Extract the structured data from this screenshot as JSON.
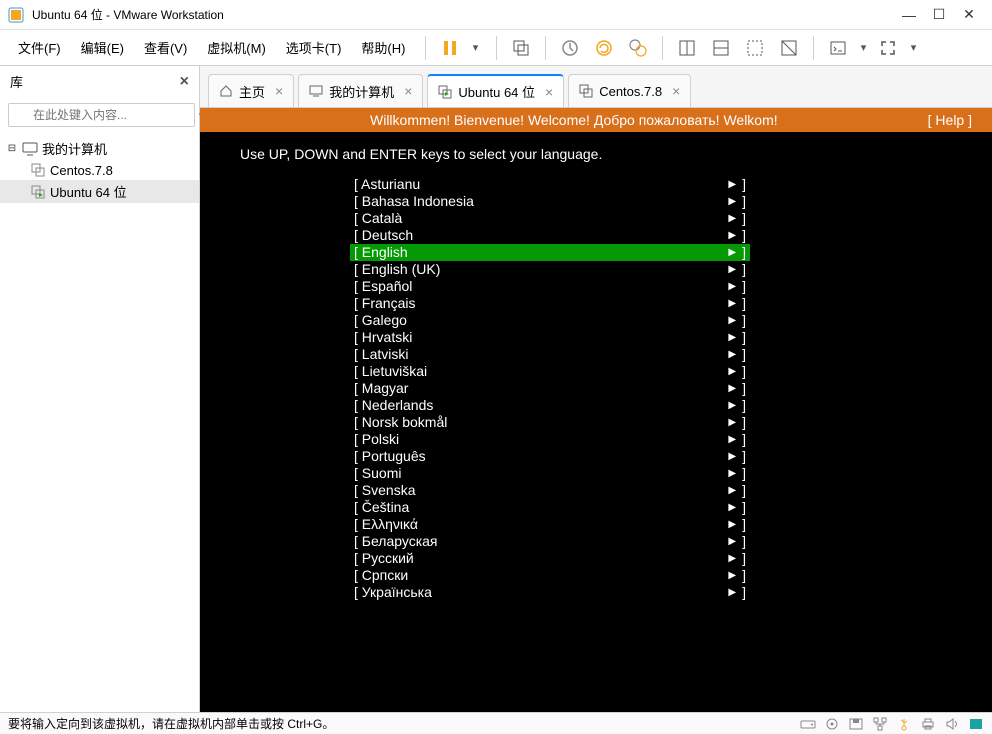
{
  "window": {
    "title": "Ubuntu 64 位 - VMware Workstation"
  },
  "menu": {
    "items": [
      "文件(F)",
      "编辑(E)",
      "查看(V)",
      "虚拟机(M)",
      "选项卡(T)",
      "帮助(H)"
    ]
  },
  "sidebar": {
    "title": "库",
    "search_placeholder": "在此处键入内容...",
    "root": "我的计算机",
    "children": [
      {
        "label": "Centos.7.8",
        "selected": false
      },
      {
        "label": "Ubuntu 64 位",
        "selected": true
      }
    ]
  },
  "tabs": [
    {
      "icon": "home",
      "label": "主页",
      "closable": true,
      "active": false
    },
    {
      "icon": "monitor",
      "label": "我的计算机",
      "closable": true,
      "active": false
    },
    {
      "icon": "vm",
      "label": "Ubuntu 64 位",
      "closable": true,
      "active": true
    },
    {
      "icon": "vm",
      "label": "Centos.7.8",
      "closable": true,
      "active": false
    }
  ],
  "installer": {
    "header_text": "Willkommen! Bienvenue! Welcome! Добро пожаловать! Welkom!",
    "help_label": "[ Help ]",
    "instruction": "Use UP, DOWN and ENTER keys to select your language.",
    "languages": [
      "Asturianu",
      "Bahasa Indonesia",
      "Català",
      "Deutsch",
      "English",
      "English (UK)",
      "Español",
      "Français",
      "Galego",
      "Hrvatski",
      "Latviski",
      "Lietuviškai",
      "Magyar",
      "Nederlands",
      "Norsk bokmål",
      "Polski",
      "Português",
      "Suomi",
      "Svenska",
      "Čeština",
      "Ελληνικά",
      "Беларуская",
      "Русский",
      "Српски",
      "Українська"
    ],
    "selected_index": 4
  },
  "statusbar": {
    "text": "要将输入定向到该虚拟机，请在虚拟机内部单击或按 Ctrl+G。"
  }
}
